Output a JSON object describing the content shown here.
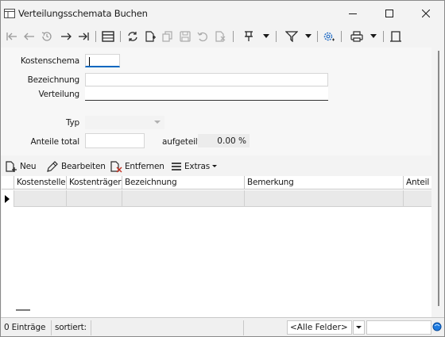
{
  "window": {
    "title": "Verteilungsschemata Buchen",
    "icon": "table-window-icon"
  },
  "toolbar": {
    "icons": [
      "first-record-icon",
      "previous-record-icon",
      "history-icon",
      "next-record-icon",
      "last-record-icon",
      "table-view-icon",
      "refresh-icon",
      "new-document-icon",
      "copy-icon",
      "save-icon",
      "undo-icon",
      "delete-document-icon",
      "pin-icon",
      "filter-icon",
      "settings-gear-icon",
      "print-icon",
      "exit-icon"
    ]
  },
  "form": {
    "kostenschema_label": "Kostenschema",
    "kostenschema_value": "",
    "bezeichnung_label": "Bezeichnung",
    "bezeichnung_value": "",
    "verteilung_label": "Verteilung",
    "verteilung_value": "",
    "typ_label": "Typ",
    "typ_value": "",
    "anteile_total_label": "Anteile total",
    "anteile_total_value": "",
    "aufgeteilt_label": "aufgeteilt",
    "aufgeteilt_value": "0.00 %"
  },
  "actions": {
    "neu": "Neu",
    "bearbeiten": "Bearbeiten",
    "entfernen": "Entfernen",
    "extras": "Extras"
  },
  "table": {
    "columns": [
      "Kostenstelle",
      "Kostenträger",
      "Bezeichnung",
      "Bemerkung",
      "Anteil"
    ],
    "rows": [
      [
        "",
        "",
        "",
        "",
        ""
      ]
    ]
  },
  "statusbar": {
    "entries": "0 Einträge",
    "sorted": "sortiert:",
    "field_filter": "<Alle Felder>",
    "search_value": ""
  },
  "colors": {
    "accent": "#0067c0",
    "window_bg": "#f3f3f3",
    "row_bg": "#e9e9e9"
  }
}
